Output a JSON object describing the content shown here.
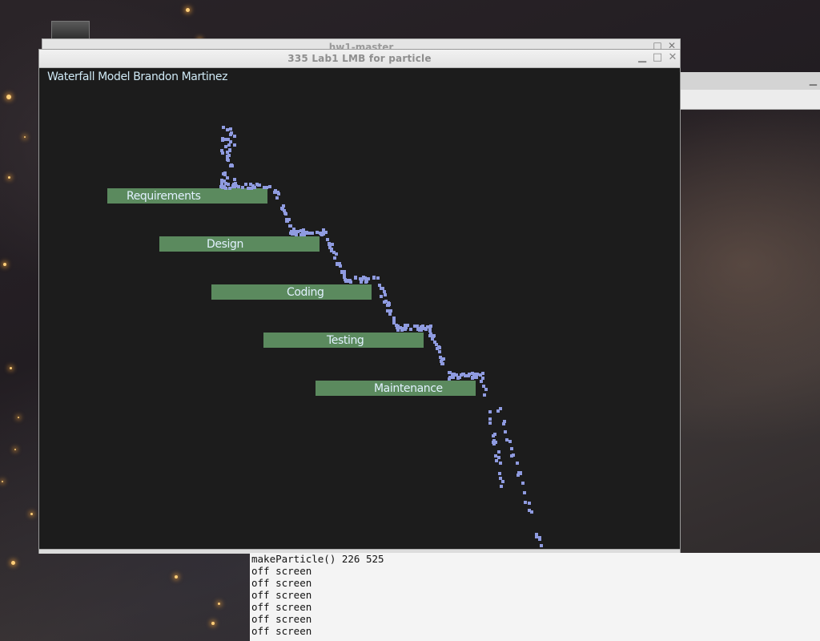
{
  "back_window": {
    "title": "hw1-master"
  },
  "main_window": {
    "title": "335 Lab1   LMB for particle",
    "heading": "Waterfall Model Brandon Martinez"
  },
  "phases": [
    {
      "label": "Requirements"
    },
    {
      "label": "Design"
    },
    {
      "label": "Coding"
    },
    {
      "label": "Testing"
    },
    {
      "label": "Maintenance"
    }
  ],
  "window_controls": {
    "minimize": "minimize-icon",
    "maximize": "maximize-icon",
    "close": "close-icon"
  },
  "colors": {
    "canvas_bg": "#1c1c1c",
    "phase_box": "#5b8a5e",
    "phase_text": "#e2f1ff",
    "particle": "#8f9be0",
    "heading_text": "#cfe9f5"
  },
  "terminal": {
    "lines": [
      "makeParticle() 226 525",
      "off screen",
      "off screen",
      "off screen",
      "off screen",
      "off screen",
      "off screen"
    ]
  }
}
